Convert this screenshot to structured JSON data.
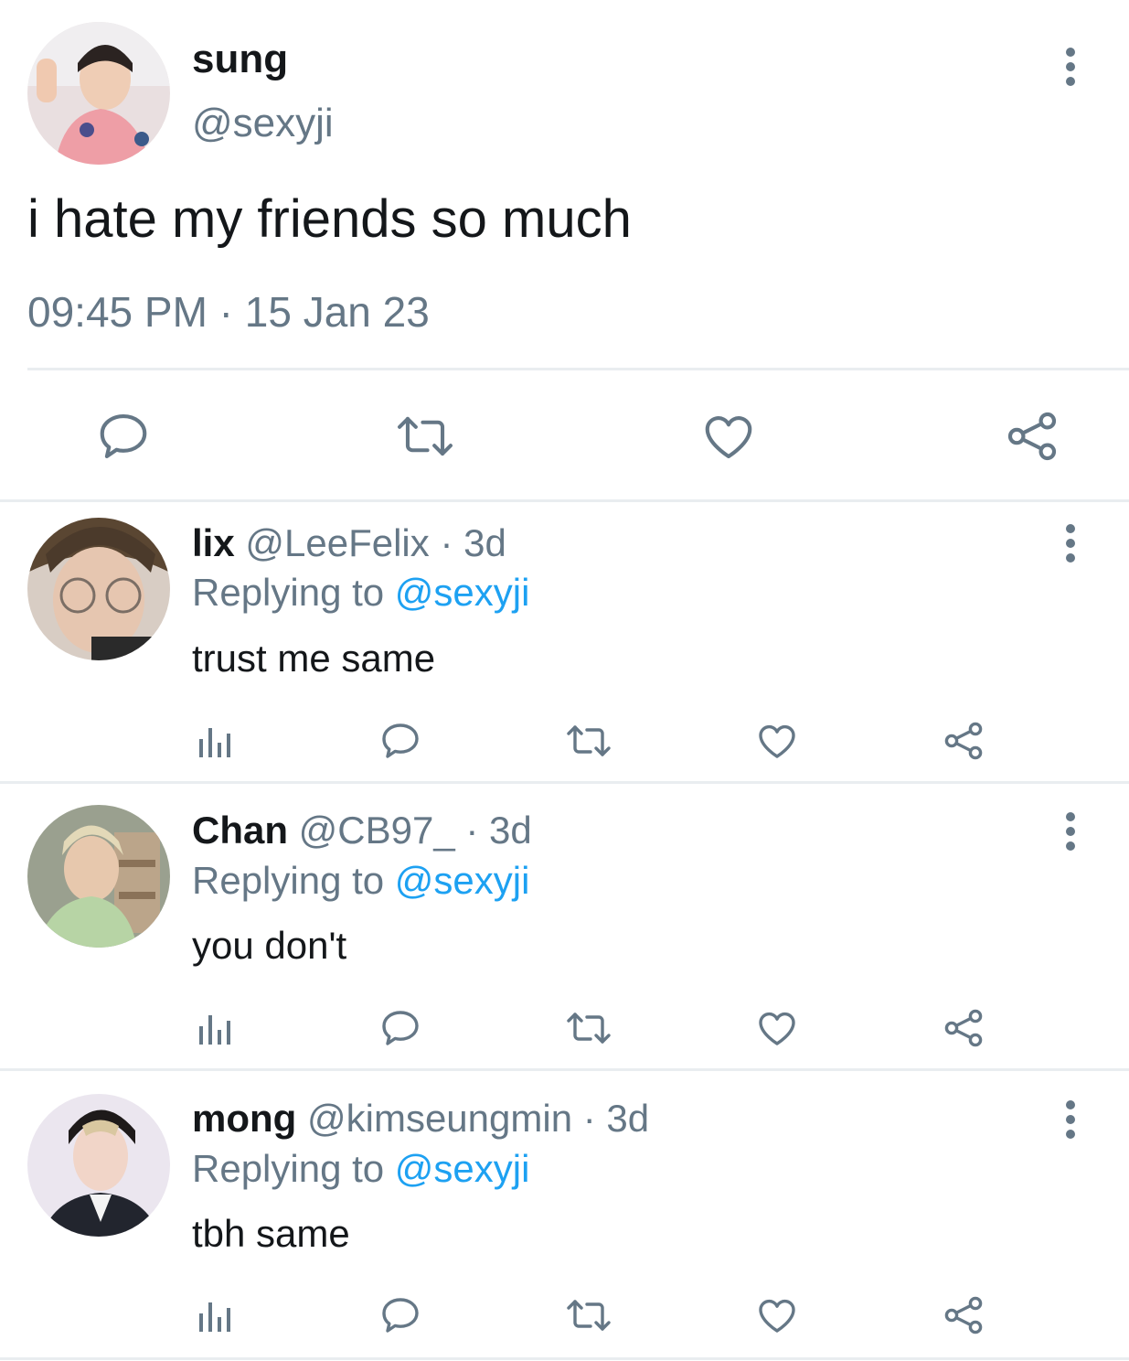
{
  "main_tweet": {
    "display_name": "sung",
    "handle": "@sexyji",
    "text": "i hate my friends so much",
    "timestamp": "09:45 PM · 15 Jan 23",
    "actions": [
      "reply-icon",
      "retweet-icon",
      "like-icon",
      "share-icon"
    ]
  },
  "replies": [
    {
      "display_name": "lix",
      "handle": "@LeeFelix",
      "age": "· 3d",
      "replying_prefix": "Replying to",
      "replying_to": "@sexyji",
      "text": "trust me same"
    },
    {
      "display_name": "Chan",
      "handle": "@CB97_",
      "age": "· 3d",
      "replying_prefix": "Replying to",
      "replying_to": "@sexyji",
      "text": "you don't"
    },
    {
      "display_name": "mong",
      "handle": "@kimseungmin",
      "age": "· 3d",
      "replying_prefix": "Replying to",
      "replying_to": "@sexyji",
      "text": "tbh same"
    }
  ],
  "reply_actions": [
    "analytics-icon",
    "reply-icon",
    "retweet-icon",
    "like-icon",
    "share-icon"
  ],
  "colors": {
    "text_primary": "#14171a",
    "text_secondary": "#657786",
    "link": "#1da1f2",
    "divider": "#e9edf0",
    "background": "#ffffff"
  }
}
